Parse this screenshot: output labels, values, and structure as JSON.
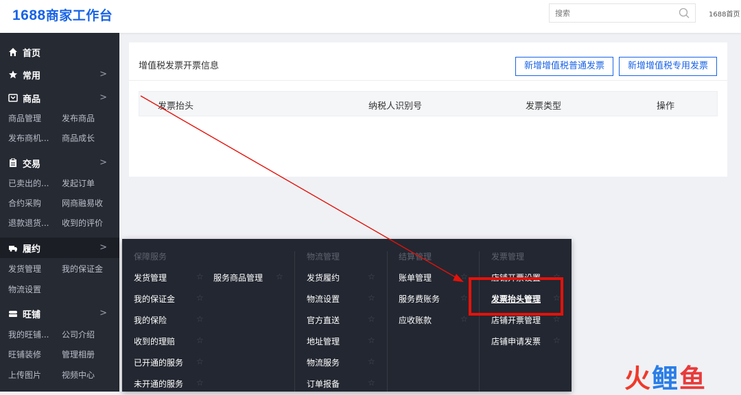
{
  "header": {
    "logo_num": "1688",
    "logo_text": "商家工作台",
    "search_placeholder": "搜索",
    "home_link": "1688首页"
  },
  "sidebar": {
    "home": "首页",
    "common": "常用",
    "goods": "商品",
    "goods_items": [
      "商品管理",
      "发布商品",
      "发布商机...",
      "商品成长"
    ],
    "trade": "交易",
    "trade_items": [
      "已卖出的...",
      "发起订单",
      "合约采购",
      "网商融易收",
      "退款退货...",
      "收到的评价"
    ],
    "fulfill": "履约",
    "fulfill_items": [
      "发货管理",
      "我的保证金",
      "物流设置"
    ],
    "shop": "旺铺",
    "shop_items": [
      "我的旺铺...",
      "公司介绍",
      "旺铺装修",
      "管理相册",
      "上传图片",
      "视频中心"
    ]
  },
  "card": {
    "title": "增值税发票开票信息",
    "btn_normal": "新增增值税普通发票",
    "btn_special": "新增增值税专用发票",
    "columns": [
      "发票抬头",
      "纳税人识别号",
      "发票类型",
      "操作"
    ]
  },
  "dropdown": {
    "col1_head": "保障服务",
    "col1_items": [
      "发货管理",
      "我的保证金",
      "我的保险",
      "收到的理赔",
      "已开通的服务",
      "未开通的服务"
    ],
    "col1b_items": [
      "服务商品管理"
    ],
    "col2_head": "物流管理",
    "col2_items": [
      "发货履约",
      "物流设置",
      "官方直送",
      "地址管理",
      "物流服务",
      "订单报备"
    ],
    "col3_head": "结算管理",
    "col3_items": [
      "账单管理",
      "服务费账务",
      "应收账款"
    ],
    "col4_head": "发票管理",
    "col4_items": [
      "店铺开票设置",
      "发票抬头管理",
      "店铺开票管理",
      "店铺申请发票"
    ]
  },
  "watermark": {
    "w1": "火",
    "w2": "鲤",
    "w3": "鱼"
  },
  "colors": {
    "accent": "#1863e6",
    "sidebar_bg": "#262a33",
    "dropdown_bg": "#232731",
    "annotation_red": "#e3120b"
  }
}
